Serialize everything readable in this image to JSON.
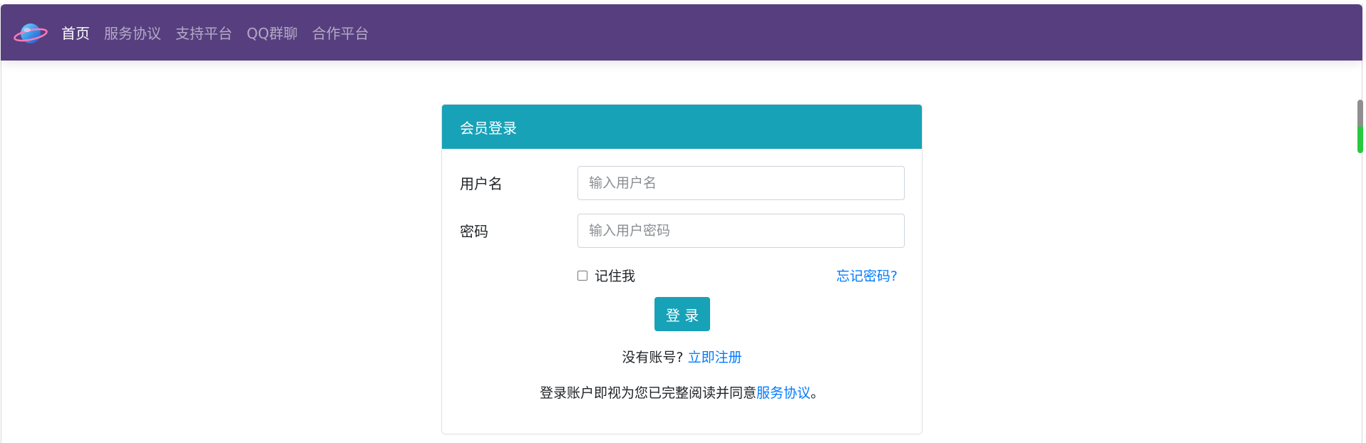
{
  "nav": {
    "logo_icon": "planet-logo-icon",
    "links": [
      {
        "label": "首页",
        "active": true
      },
      {
        "label": "服务协议",
        "active": false
      },
      {
        "label": "支持平台",
        "active": false
      },
      {
        "label": "QQ群聊",
        "active": false
      },
      {
        "label": "合作平台",
        "active": false
      }
    ],
    "bg_color": "#573f7f"
  },
  "login_card": {
    "title": "会员登录",
    "header_color": "#17a2b8",
    "username_label": "用户名",
    "username_placeholder": "输入用户名",
    "username_value": "",
    "password_label": "密码",
    "password_placeholder": "输入用户密码",
    "password_value": "",
    "remember_label": "记住我",
    "remember_checked": false,
    "forgot_label": "忘记密码?",
    "login_button": "登 录",
    "no_account_text": "没有账号?",
    "register_link": "立即注册",
    "terms_prefix": "登录账户即视为您已完整阅读并同意",
    "terms_link": "服务协议",
    "terms_suffix": "。"
  }
}
